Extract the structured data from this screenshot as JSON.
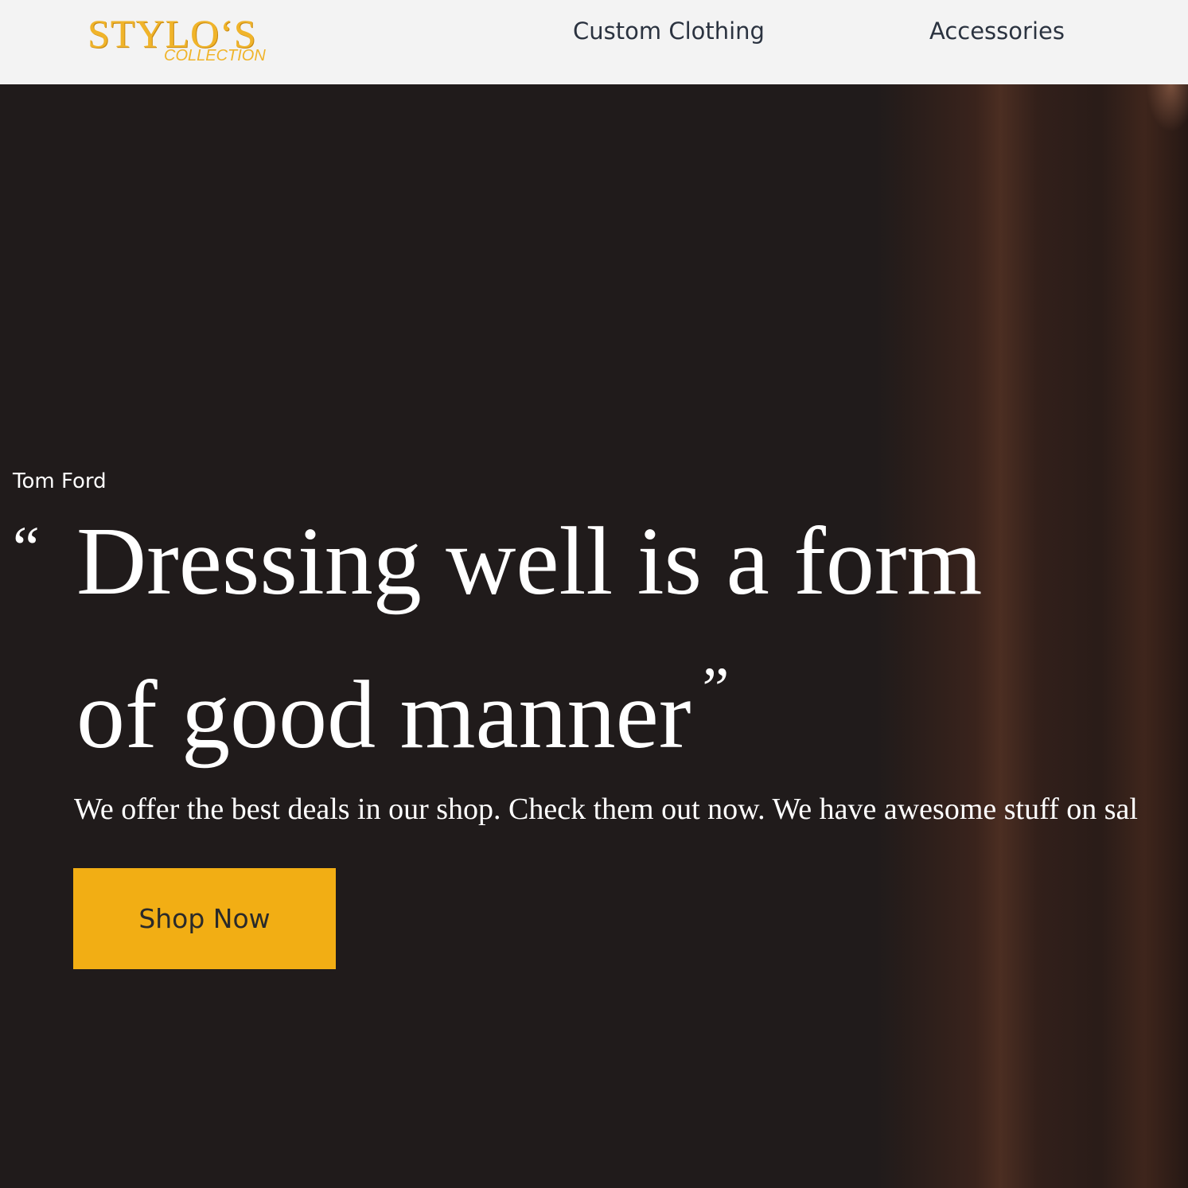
{
  "header": {
    "logo": {
      "main": "STYLO‘S",
      "sub": "COLLECTION"
    },
    "nav": {
      "custom_clothing": "Custom Clothing",
      "accessories": "Accessories"
    }
  },
  "hero": {
    "author": "Tom Ford",
    "open_quote": "“",
    "quote_line_1": "Dressing well is a form",
    "quote_line_2": "of good manner",
    "close_quote": "”",
    "tagline": "We offer the best deals in our shop. Check them out now. We have awesome stuff on sal",
    "cta_label": "Shop Now"
  },
  "colors": {
    "accent": "#f2ae14",
    "logo": "#f0b42a",
    "hero_background": "#201b1b",
    "header_background": "#f3f3f3",
    "nav_text": "#2b3340"
  }
}
